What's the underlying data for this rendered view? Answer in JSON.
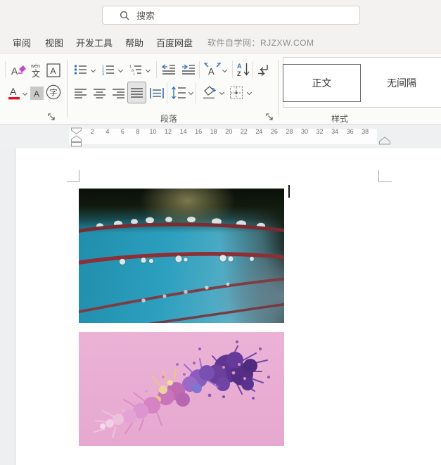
{
  "search": {
    "placeholder": "搜索"
  },
  "tabs": {
    "items": [
      {
        "label": "审阅"
      },
      {
        "label": "视图"
      },
      {
        "label": "开发工具"
      },
      {
        "label": "帮助"
      },
      {
        "label": "百度网盘"
      }
    ],
    "brand": "软件自学网：RJZXW.COM"
  },
  "ribbon": {
    "font": {
      "clear_format_glyph": "A",
      "phonetic_top": "wén",
      "phonetic_bottom": "文",
      "char_border_glyph": "A",
      "font_color_glyph": "A",
      "char_shading_glyph": "A",
      "enclose_glyph": "字"
    },
    "paragraph": {
      "label": "段落",
      "num1": "1",
      "num2": "2",
      "num3": "3",
      "ml1": "1",
      "ml2": "a",
      "ml3": "i",
      "scale_glyph": "A",
      "sort_a": "A",
      "sort_z": "Z"
    },
    "styles": {
      "label": "样式",
      "items": [
        {
          "label": "正文",
          "selected": true
        },
        {
          "label": "无间隔",
          "selected": false
        }
      ]
    }
  },
  "ruler": {
    "numbers": [
      2,
      4,
      6,
      8,
      10,
      12,
      14,
      16,
      18,
      20,
      22,
      24,
      26,
      28,
      30,
      32,
      34,
      36,
      38
    ]
  },
  "document": {
    "cursor_visible": true,
    "images": [
      {
        "name": "red-twigs-with-water-drops-over-teal-water",
        "colors": {
          "top_dark": "#121a0d",
          "olive_blur": "#807d50",
          "teal": "#2da0bf",
          "twig_red": "#8e2e35"
        }
      },
      {
        "name": "purple-coral-flower-on-pink-background",
        "colors": {
          "background_pink": "#e9aed3",
          "dark_purple": "#5e3590",
          "violet": "#8a5cc0",
          "magenta": "#c06ab6",
          "cream": "#eed29e",
          "pale_pink": "#edc0de"
        }
      }
    ]
  },
  "colors": {
    "accent_blue": "#2f6fb7",
    "font_color_red": "#e81123",
    "bar_bg": "#f3f2f1"
  }
}
